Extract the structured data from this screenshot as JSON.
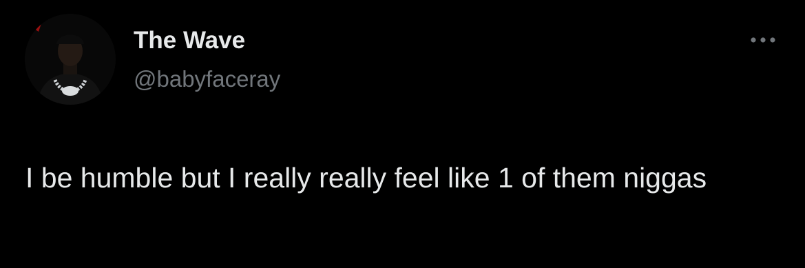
{
  "tweet": {
    "display_name": "The Wave",
    "handle": "@babyfaceray",
    "text": "I be humble but I really really feel like 1 of them niggas",
    "more_icon": "more-horizontal-icon"
  },
  "colors": {
    "background": "#000000",
    "primary_text": "#e7e9ea",
    "secondary_text": "#71767b"
  }
}
